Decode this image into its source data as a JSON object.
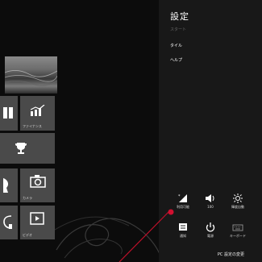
{
  "charms": {
    "title": "設定",
    "menu": [
      {
        "label": "スタート",
        "dim": true
      },
      {
        "label": "タイル",
        "dim": false
      },
      {
        "label": "ヘルプ",
        "dim": false
      }
    ],
    "quick_settings": [
      {
        "label": "利用可能",
        "icon": "wifi-signal-icon"
      },
      {
        "label": "100",
        "icon": "volume-icon"
      },
      {
        "label": "輝度自動",
        "icon": "brightness-icon"
      },
      {
        "label": "通知",
        "icon": "notifications-icon"
      },
      {
        "label": "電源",
        "icon": "power-icon"
      },
      {
        "label": "キーボード",
        "icon": "keyboard-icon"
      }
    ],
    "footer": "PC 設定の変更"
  },
  "start": {
    "tiles": [
      {
        "name": "news-tile",
        "label": ""
      },
      {
        "name": "finance-tile",
        "label": "ファイナンス"
      },
      {
        "name": "sports-tile",
        "label": ""
      },
      {
        "name": "people-tile",
        "label": ""
      },
      {
        "name": "camera-tile",
        "label": "カメラ"
      },
      {
        "name": "music-tile",
        "label": ""
      },
      {
        "name": "video-tile",
        "label": "ビデオ"
      }
    ]
  },
  "colors": {
    "charms_bg": "#181818",
    "tile_bg": "#4a4a4a",
    "pointer_line": "#c0102a"
  }
}
